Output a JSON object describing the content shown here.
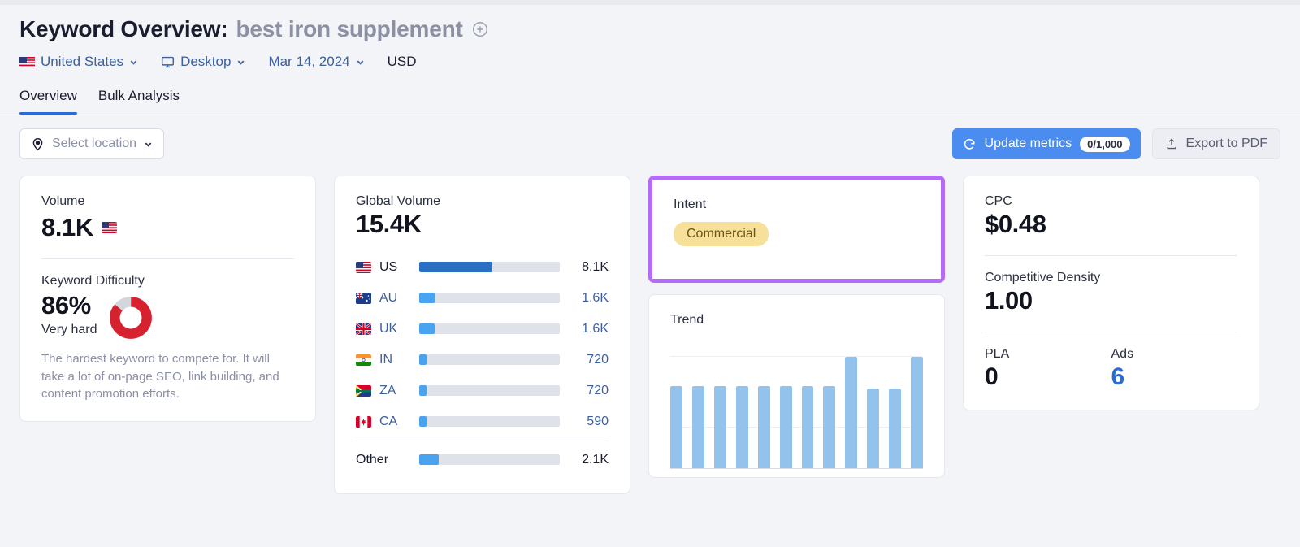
{
  "header": {
    "title_prefix": "Keyword Overview:",
    "keyword": "best iron supplement",
    "add_icon": "plus-circle-icon",
    "meta": {
      "country": "United States",
      "device": "Desktop",
      "date": "Mar 14, 2024",
      "currency": "USD"
    }
  },
  "tabs": [
    {
      "label": "Overview",
      "active": true
    },
    {
      "label": "Bulk Analysis",
      "active": false
    }
  ],
  "toolbar": {
    "location_placeholder": "Select location",
    "update_label": "Update metrics",
    "update_quota": "0/1,000",
    "export_label": "Export to PDF",
    "accent_blue": "#4a8cf0"
  },
  "volume_card": {
    "volume_label": "Volume",
    "volume_value": "8.1K",
    "volume_flag": "us-flag-icon",
    "kd_label": "Keyword Difficulty",
    "kd_value": "86%",
    "kd_status": "Very hard",
    "kd_description": "The hardest keyword to compete for. It will take a lot of on-page SEO, link building, and content promotion efforts.",
    "kd_percent": 86,
    "kd_color": "#d6212e",
    "kd_track_color": "#d3d6dd"
  },
  "global_volume_card": {
    "label": "Global Volume",
    "value": "15.4K",
    "rows": [
      {
        "flag": "us-flag-icon",
        "code": "US",
        "value": "8.1K",
        "pct": 52,
        "color": "#2a6fc4",
        "dark": true
      },
      {
        "flag": "au-flag-icon",
        "code": "AU",
        "value": "1.6K",
        "pct": 11,
        "color": "#4aa3f0",
        "dark": false
      },
      {
        "flag": "uk-flag-icon",
        "code": "UK",
        "value": "1.6K",
        "pct": 11,
        "color": "#4aa3f0",
        "dark": false
      },
      {
        "flag": "in-flag-icon",
        "code": "IN",
        "value": "720",
        "pct": 5,
        "color": "#4aa3f0",
        "dark": false
      },
      {
        "flag": "za-flag-icon",
        "code": "ZA",
        "value": "720",
        "pct": 5,
        "color": "#4aa3f0",
        "dark": false
      },
      {
        "flag": "ca-flag-icon",
        "code": "CA",
        "value": "590",
        "pct": 5,
        "color": "#4aa3f0",
        "dark": false
      }
    ],
    "other": {
      "code": "Other",
      "value": "2.1K",
      "pct": 14,
      "color": "#4aa3f0",
      "dark": true
    }
  },
  "intent_card": {
    "label": "Intent",
    "badge": "Commercial",
    "badge_bg": "#f6e09a",
    "badge_text_color": "#6b5418",
    "highlight_color": "#b36cf5"
  },
  "cpc_card": {
    "cpc_label": "CPC",
    "cpc_value": "$0.48",
    "density_label": "Competitive Density",
    "density_value": "1.00",
    "pla_label": "PLA",
    "pla_value": "0",
    "ads_label": "Ads",
    "ads_value": "6"
  },
  "chart_data": {
    "type": "bar",
    "title": "Trend",
    "categories": [
      "1",
      "2",
      "3",
      "4",
      "5",
      "6",
      "7",
      "8",
      "9",
      "10",
      "11",
      "12"
    ],
    "values": [
      68,
      68,
      68,
      68,
      68,
      68,
      68,
      68,
      92,
      66,
      66,
      92
    ],
    "xlabel": "",
    "ylabel": "",
    "ylim": [
      0,
      100
    ],
    "grid": true,
    "gridlines": [
      34,
      92
    ],
    "bar_color": "#93c3ec",
    "legend": null
  }
}
